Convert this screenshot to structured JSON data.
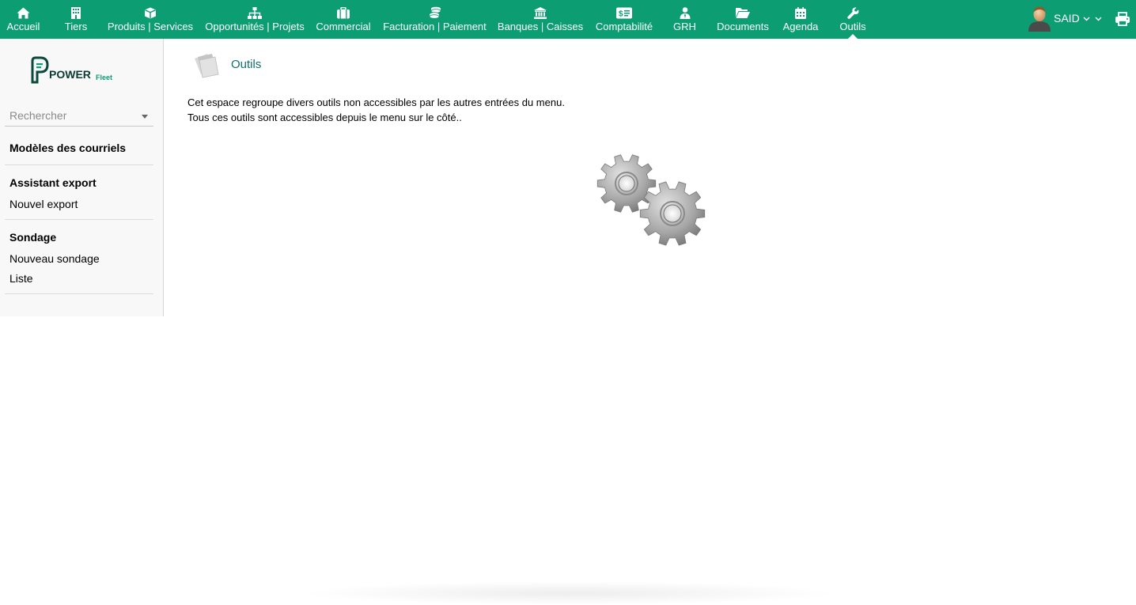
{
  "topnav": {
    "items": [
      {
        "label": "Accueil",
        "icon": "home-icon"
      },
      {
        "label": "Tiers",
        "icon": "building-icon"
      },
      {
        "label": "Produits | Services",
        "icon": "cube-icon"
      },
      {
        "label": "Opportunités | Projets",
        "icon": "sitemap-icon"
      },
      {
        "label": "Commercial",
        "icon": "suitcase-icon"
      },
      {
        "label": "Facturation | Paiement",
        "icon": "coins-icon"
      },
      {
        "label": "Banques | Caisses",
        "icon": "bank-icon"
      },
      {
        "label": "Comptabilité",
        "icon": "ledger-icon"
      },
      {
        "label": "GRH",
        "icon": "user-tie-icon"
      },
      {
        "label": "Documents",
        "icon": "folder-open-icon"
      },
      {
        "label": "Agenda",
        "icon": "calendar-icon"
      },
      {
        "label": "Outils",
        "icon": "wrench-icon"
      }
    ],
    "active": "Outils",
    "user_name": "SAID",
    "bar_color": "#0c9d73"
  },
  "sidebar": {
    "logo": {
      "word": "POWER",
      "sub": "Fleet"
    },
    "search_placeholder": "Rechercher",
    "sections": [
      {
        "title": "Modèles des courriels",
        "links": []
      },
      {
        "title": "Assistant export",
        "links": [
          "Nouvel export"
        ]
      },
      {
        "title": "Sondage",
        "links": [
          "Nouveau sondage",
          "Liste"
        ]
      }
    ]
  },
  "main": {
    "title": "Outils",
    "title_color": "#126f6f",
    "description_line1": "Cet espace regroupe divers outils non accessibles par les autres entrées du menu.",
    "description_line2": "Tous ces outils sont accessibles depuis le menu sur le côté..",
    "illustration": "gears-icon"
  }
}
